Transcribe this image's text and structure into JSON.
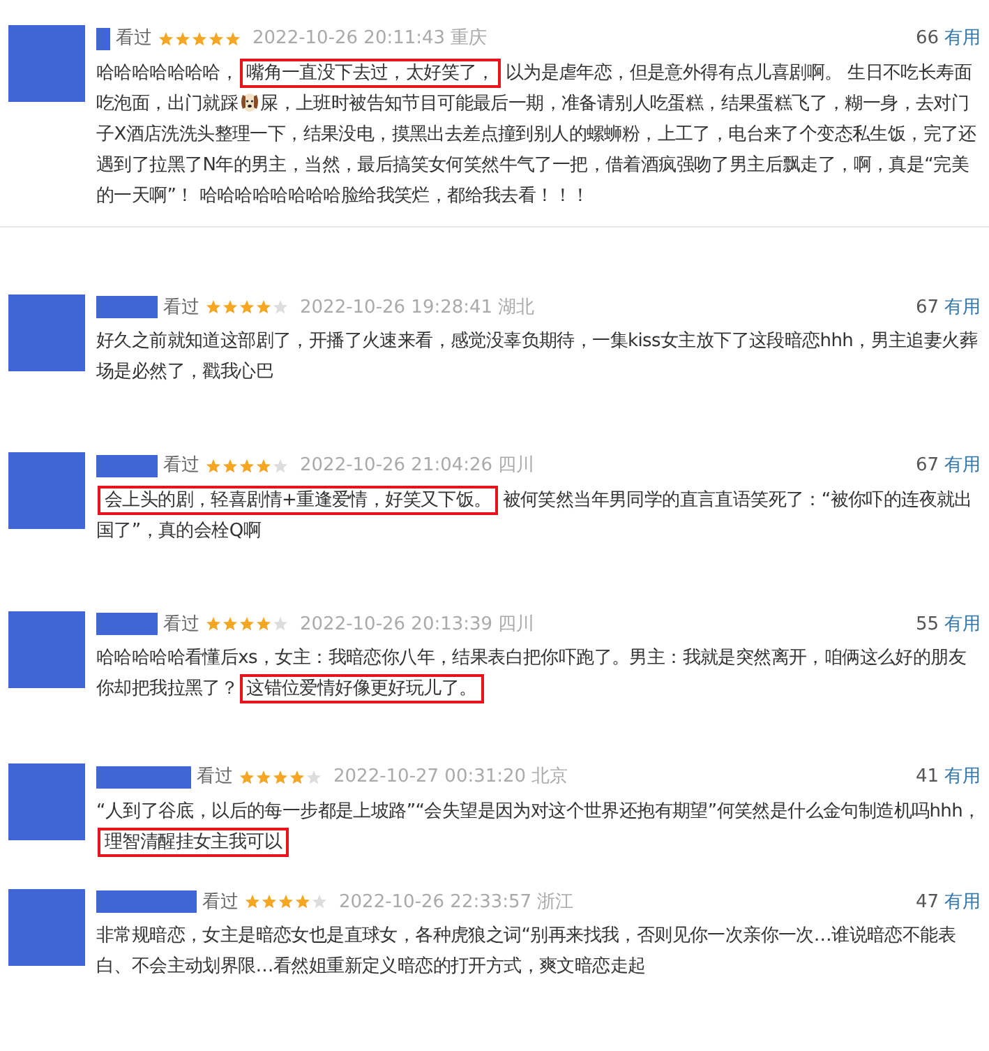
{
  "reviews": [
    {
      "status": "看过",
      "stars": 5,
      "time": "2022-10-26 20:11:43",
      "location": "重庆",
      "useful_count": "66",
      "useful_label": "有用",
      "comment": [
        {
          "kind": "text",
          "text": "哈哈哈哈哈哈哈，",
          "highlighted": false
        },
        {
          "kind": "text",
          "text": "嘴角一直没下去过，太好笑了，",
          "highlighted": true
        },
        {
          "kind": "text",
          "text": "以为是虐年恋，但是意外得有点儿喜剧啊。 生日不吃长寿面吃泡面，出门就踩",
          "highlighted": false
        },
        {
          "kind": "emoji"
        },
        {
          "kind": "text",
          "text": "屎，上班时被告知节目可能最后一期，准备请别人吃蛋糕，结果蛋糕飞了，糊一身，去对门子X酒店洗洗头整理一下，结果没电，摸黑出去差点撞到别人的螺蛳粉，上工了，电台来了个变态私生饭，完了还遇到了拉黑了N年的男主，当然，最后搞笑女何笑然牛气了一把，借着酒疯强吻了男主后飘走了，啊，真是“完美的一天啊”！ 哈哈哈哈哈哈哈哈脸给我笑烂，都给我去看！！！",
          "highlighted": false
        }
      ]
    },
    {
      "status": "看过",
      "stars": 4,
      "time": "2022-10-26 19:28:41",
      "location": "湖北",
      "useful_count": "67",
      "useful_label": "有用",
      "comment": [
        {
          "kind": "text",
          "text": "好久之前就知道这部剧了，开播了火速来看，感觉没辜负期待，一集kiss女主放下了这段暗恋hhh，男主追妻火葬场是必然了，戳我心巴",
          "highlighted": false
        }
      ]
    },
    {
      "status": "看过",
      "stars": 4,
      "time": "2022-10-26 21:04:26",
      "location": "四川",
      "useful_count": "67",
      "useful_label": "有用",
      "comment": [
        {
          "kind": "text",
          "text": "会上头的剧，轻喜剧情+重逢爱情，好笑又下饭。",
          "highlighted": true
        },
        {
          "kind": "text",
          "text": "被何笑然当年男同学的直言直语笑死了：“被你吓的连夜就出国了”，真的会栓Q啊",
          "highlighted": false
        }
      ]
    },
    {
      "status": "看过",
      "stars": 4,
      "time": "2022-10-26 20:13:39",
      "location": "四川",
      "useful_count": "55",
      "useful_label": "有用",
      "comment": [
        {
          "kind": "text",
          "text": "哈哈哈哈哈看懂后xs，女主：我暗恋你八年，结果表白把你吓跑了。男主：我就是突然离开，咱俩这么好的朋友你却把我拉黑了？",
          "highlighted": false
        },
        {
          "kind": "text",
          "text": "这错位爱情好像更好玩儿了。",
          "highlighted": true
        }
      ]
    },
    {
      "status": "看过",
      "stars": 4,
      "time": "2022-10-27 00:31:20",
      "location": "北京",
      "useful_count": "41",
      "useful_label": "有用",
      "comment": [
        {
          "kind": "text",
          "text": "“人到了谷底，以后的每一步都是上坡路”“会失望是因为对这个世界还抱有期望”何笑然是什么金句制造机吗hhh，",
          "highlighted": false
        },
        {
          "kind": "text",
          "text": "理智清醒挂女主我可以",
          "highlighted": true
        }
      ]
    },
    {
      "status": "看过",
      "stars": 4,
      "time": "2022-10-26 22:33:57",
      "location": "浙江",
      "useful_count": "47",
      "useful_label": "有用",
      "comment": [
        {
          "kind": "text",
          "text": "非常规暗恋，女主是暗恋女也是直球女，各种虎狼之词“别再来找我，否则见你一次亲你一次…谁说暗恋不能表白、不会主动划界限…看然姐重新定义暗恋的打开方式，爽文暗恋走起",
          "highlighted": false
        }
      ]
    }
  ]
}
